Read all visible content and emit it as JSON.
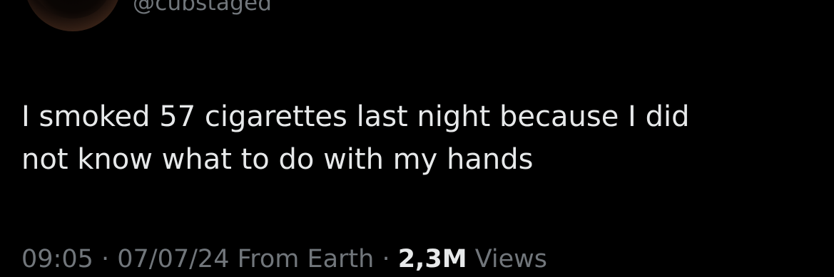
{
  "tweet": {
    "handle": "@cubstaged",
    "text_line_1": "I smoked 57 cigarettes last night because I did",
    "text_line_2": "not know what to do with my hands",
    "time": "09:05",
    "separator": " · ",
    "date": "07/07/24",
    "source": "From Earth",
    "views_count": "2,3M",
    "views_label": "Views"
  },
  "colors": {
    "background": "#000000",
    "primary_text": "#e7e9ea",
    "secondary_text": "#71767b"
  }
}
